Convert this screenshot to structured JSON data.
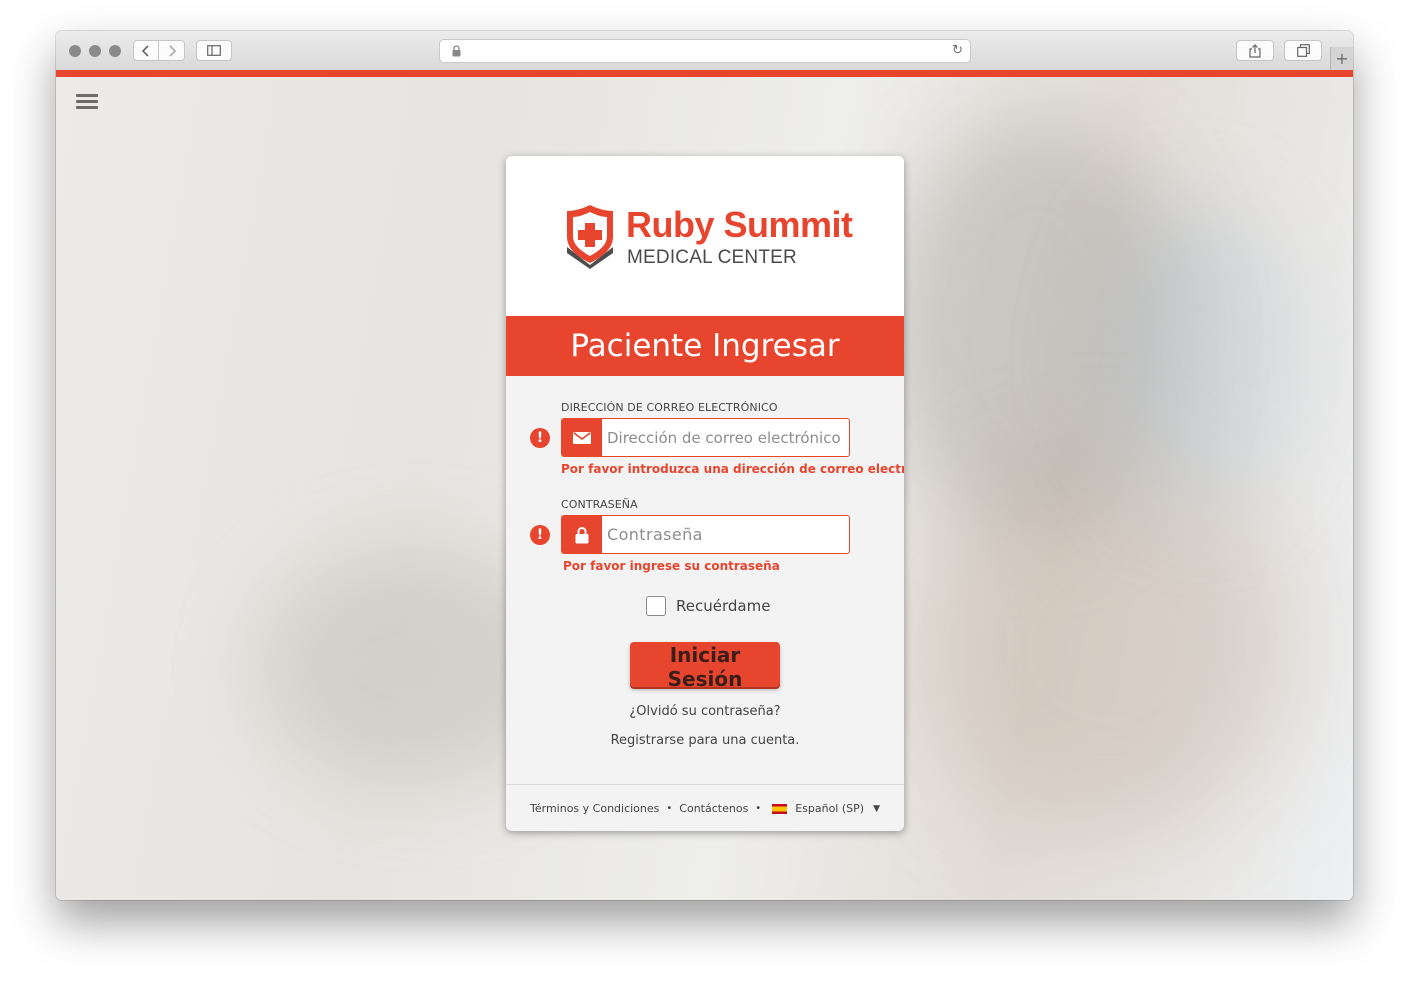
{
  "browser": {
    "url_text": "",
    "new_tab_label": "+"
  },
  "brand": {
    "name": "Ruby Summit",
    "subtitle": "MEDICAL CENTER",
    "accent_color": "#e8452f"
  },
  "login": {
    "title": "Paciente Ingresar",
    "email": {
      "label": "DIRECCIÓN DE CORREO ELECTRÓNICO",
      "placeholder": "Dirección de correo electrónico",
      "value": "",
      "error": "Por favor introduzca una dirección de correo electrónico.",
      "icon": "envelope-icon"
    },
    "password": {
      "label": "CONTRASEÑA",
      "placeholder": "Contraseña",
      "value": "",
      "error": "Por favor ingrese su contraseña",
      "icon": "lock-icon"
    },
    "error_icon_glyph": "!",
    "remember_label": "Recuérdame",
    "remember_checked": false,
    "submit_label": "Iniciar Sesión",
    "forgot_link": "¿Olvidó su contraseña?",
    "register_link": "Registrarse para una cuenta."
  },
  "footer": {
    "terms": "Términos y Condiciones",
    "separator": "•",
    "contact": "Contáctenos",
    "language": "Español (SP)",
    "language_caret": "▼"
  }
}
